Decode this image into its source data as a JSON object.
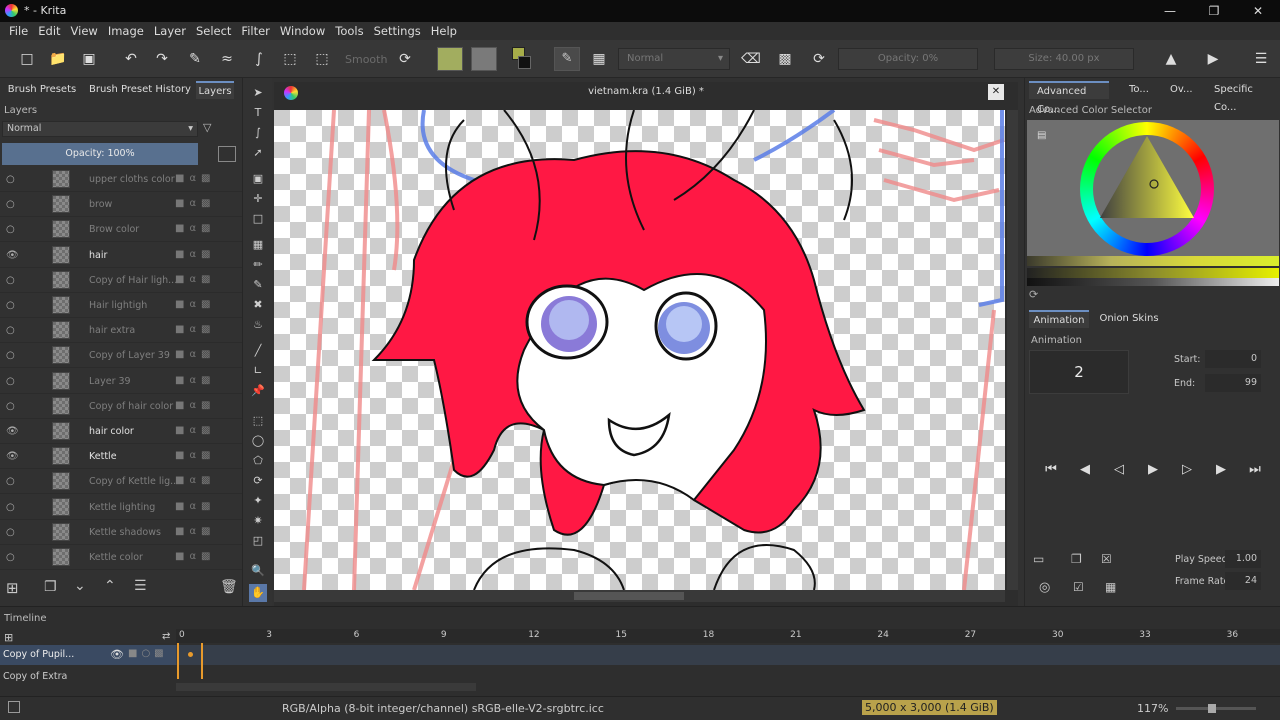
{
  "window": {
    "title": "* - Krita"
  },
  "menu": [
    "File",
    "Edit",
    "View",
    "Image",
    "Layer",
    "Select",
    "Filter",
    "Window",
    "Tools",
    "Settings",
    "Help"
  ],
  "toolbar": {
    "smooth_label": "Smooth",
    "blend_mode": "Normal",
    "opacity": "Opacity: 0%",
    "size": "Size: 40.00 px"
  },
  "left_tabs": [
    "Brush Presets",
    "Brush Preset History",
    "Layers"
  ],
  "layers_panel": {
    "title": "Layers",
    "blend_mode": "Normal",
    "opacity": "Opacity:  100%",
    "layers": [
      {
        "name": "upper cloths color",
        "visible": false
      },
      {
        "name": "brow",
        "visible": false
      },
      {
        "name": "Brow color",
        "visible": false
      },
      {
        "name": "hair",
        "visible": true
      },
      {
        "name": "Copy of Hair ligh...",
        "visible": false
      },
      {
        "name": "Hair lightigh",
        "visible": false
      },
      {
        "name": "hair extra",
        "visible": false
      },
      {
        "name": "Copy of Layer 39",
        "visible": false
      },
      {
        "name": "Layer 39",
        "visible": false
      },
      {
        "name": "Copy of hair color",
        "visible": false
      },
      {
        "name": "hair color",
        "visible": true
      },
      {
        "name": "Kettle",
        "visible": true
      },
      {
        "name": "Copy of Kettle lig...",
        "visible": false
      },
      {
        "name": "Kettle lighting",
        "visible": false
      },
      {
        "name": "Kettle shadows",
        "visible": false
      },
      {
        "name": "Kettle color",
        "visible": false
      }
    ]
  },
  "document": {
    "title": "vietnam.kra (1.4 GiB) *"
  },
  "right_tabs": [
    "Advanced Co...",
    "To...",
    "Ov...",
    "Specific Co..."
  ],
  "color_selector": {
    "title": "Advanced Color Selector"
  },
  "anim_tabs": [
    "Animation",
    "Onion Skins"
  ],
  "animation": {
    "title": "Animation",
    "frame": "2",
    "start_label": "Start:",
    "start": "0",
    "end_label": "End:",
    "end": "99",
    "speed_label": "Play Speed:",
    "speed": "1.00",
    "rate_label": "Frame Rate:",
    "rate": "24"
  },
  "timeline": {
    "title": "Timeline",
    "ticks": [
      "0",
      "3",
      "6",
      "9",
      "12",
      "15",
      "18",
      "21",
      "24",
      "27",
      "30",
      "33",
      "36"
    ],
    "rows": [
      "Copy of Pupil...",
      "Copy of Extra"
    ]
  },
  "status": {
    "color": "RGB/Alpha (8-bit integer/channel)  sRGB-elle-V2-srgbtrc.icc",
    "size": "5,000 x 3,000 (1.4 GiB)",
    "zoom": "117%"
  }
}
